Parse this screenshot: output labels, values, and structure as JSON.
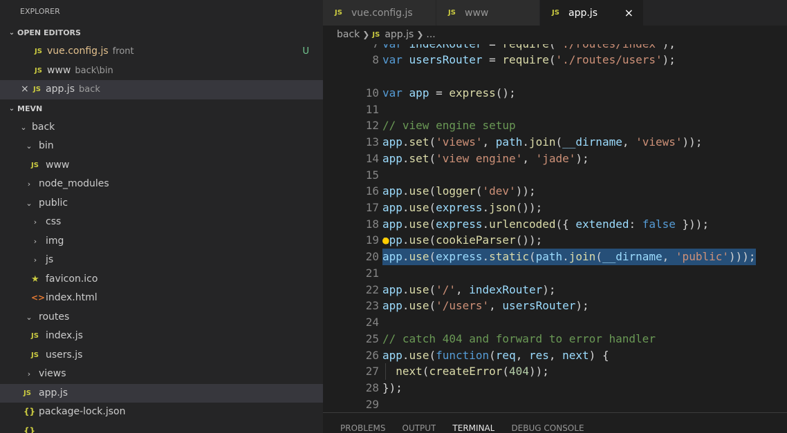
{
  "explorer": {
    "title": "EXPLORER",
    "open_editors_title": "OPEN EDITORS",
    "open_editors": [
      {
        "name": "vue.config.js",
        "desc": "front",
        "badge": "U"
      },
      {
        "name": "www",
        "desc": "back\\bin"
      },
      {
        "name": "app.js",
        "desc": "back"
      }
    ],
    "project_title": "MEVN",
    "tree": [
      {
        "label": "back"
      },
      {
        "label": "bin"
      },
      {
        "label": "www"
      },
      {
        "label": "node_modules"
      },
      {
        "label": "public"
      },
      {
        "label": "css"
      },
      {
        "label": "img"
      },
      {
        "label": "js"
      },
      {
        "label": "favicon.ico"
      },
      {
        "label": "index.html"
      },
      {
        "label": "routes"
      },
      {
        "label": "index.js"
      },
      {
        "label": "users.js"
      },
      {
        "label": "views"
      },
      {
        "label": "app.js"
      },
      {
        "label": "package-lock.json"
      }
    ]
  },
  "tabs": [
    {
      "label": "vue.config.js"
    },
    {
      "label": "www"
    },
    {
      "label": "app.js"
    }
  ],
  "icons": {
    "js": "JS",
    "close": "×",
    "json": "{}",
    "html": "<>"
  },
  "breadcrumb": {
    "folder": "back",
    "file": "app.js",
    "more": "..."
  },
  "editor": {
    "lines": [
      {
        "n": "7"
      },
      {
        "n": "8"
      },
      {
        "n": "10"
      },
      {
        "n": "11"
      },
      {
        "n": "12"
      },
      {
        "n": "13"
      },
      {
        "n": "14"
      },
      {
        "n": "15"
      },
      {
        "n": "16"
      },
      {
        "n": "17"
      },
      {
        "n": "18"
      },
      {
        "n": "19"
      },
      {
        "n": "20"
      },
      {
        "n": "21"
      },
      {
        "n": "22"
      },
      {
        "n": "23"
      },
      {
        "n": "24"
      },
      {
        "n": "25"
      },
      {
        "n": "26"
      },
      {
        "n": "27"
      },
      {
        "n": "28"
      },
      {
        "n": "29"
      }
    ]
  },
  "panel": {
    "tabs": [
      {
        "label": "PROBLEMS"
      },
      {
        "label": "OUTPUT"
      },
      {
        "label": "TERMINAL"
      },
      {
        "label": "DEBUG CONSOLE"
      }
    ]
  },
  "colors": {
    "sidebar_bg": "#252526",
    "editor_bg": "#1e1e1e",
    "selection": "#264f78",
    "js_icon": "#cbcb41",
    "untracked": "#73c991"
  }
}
